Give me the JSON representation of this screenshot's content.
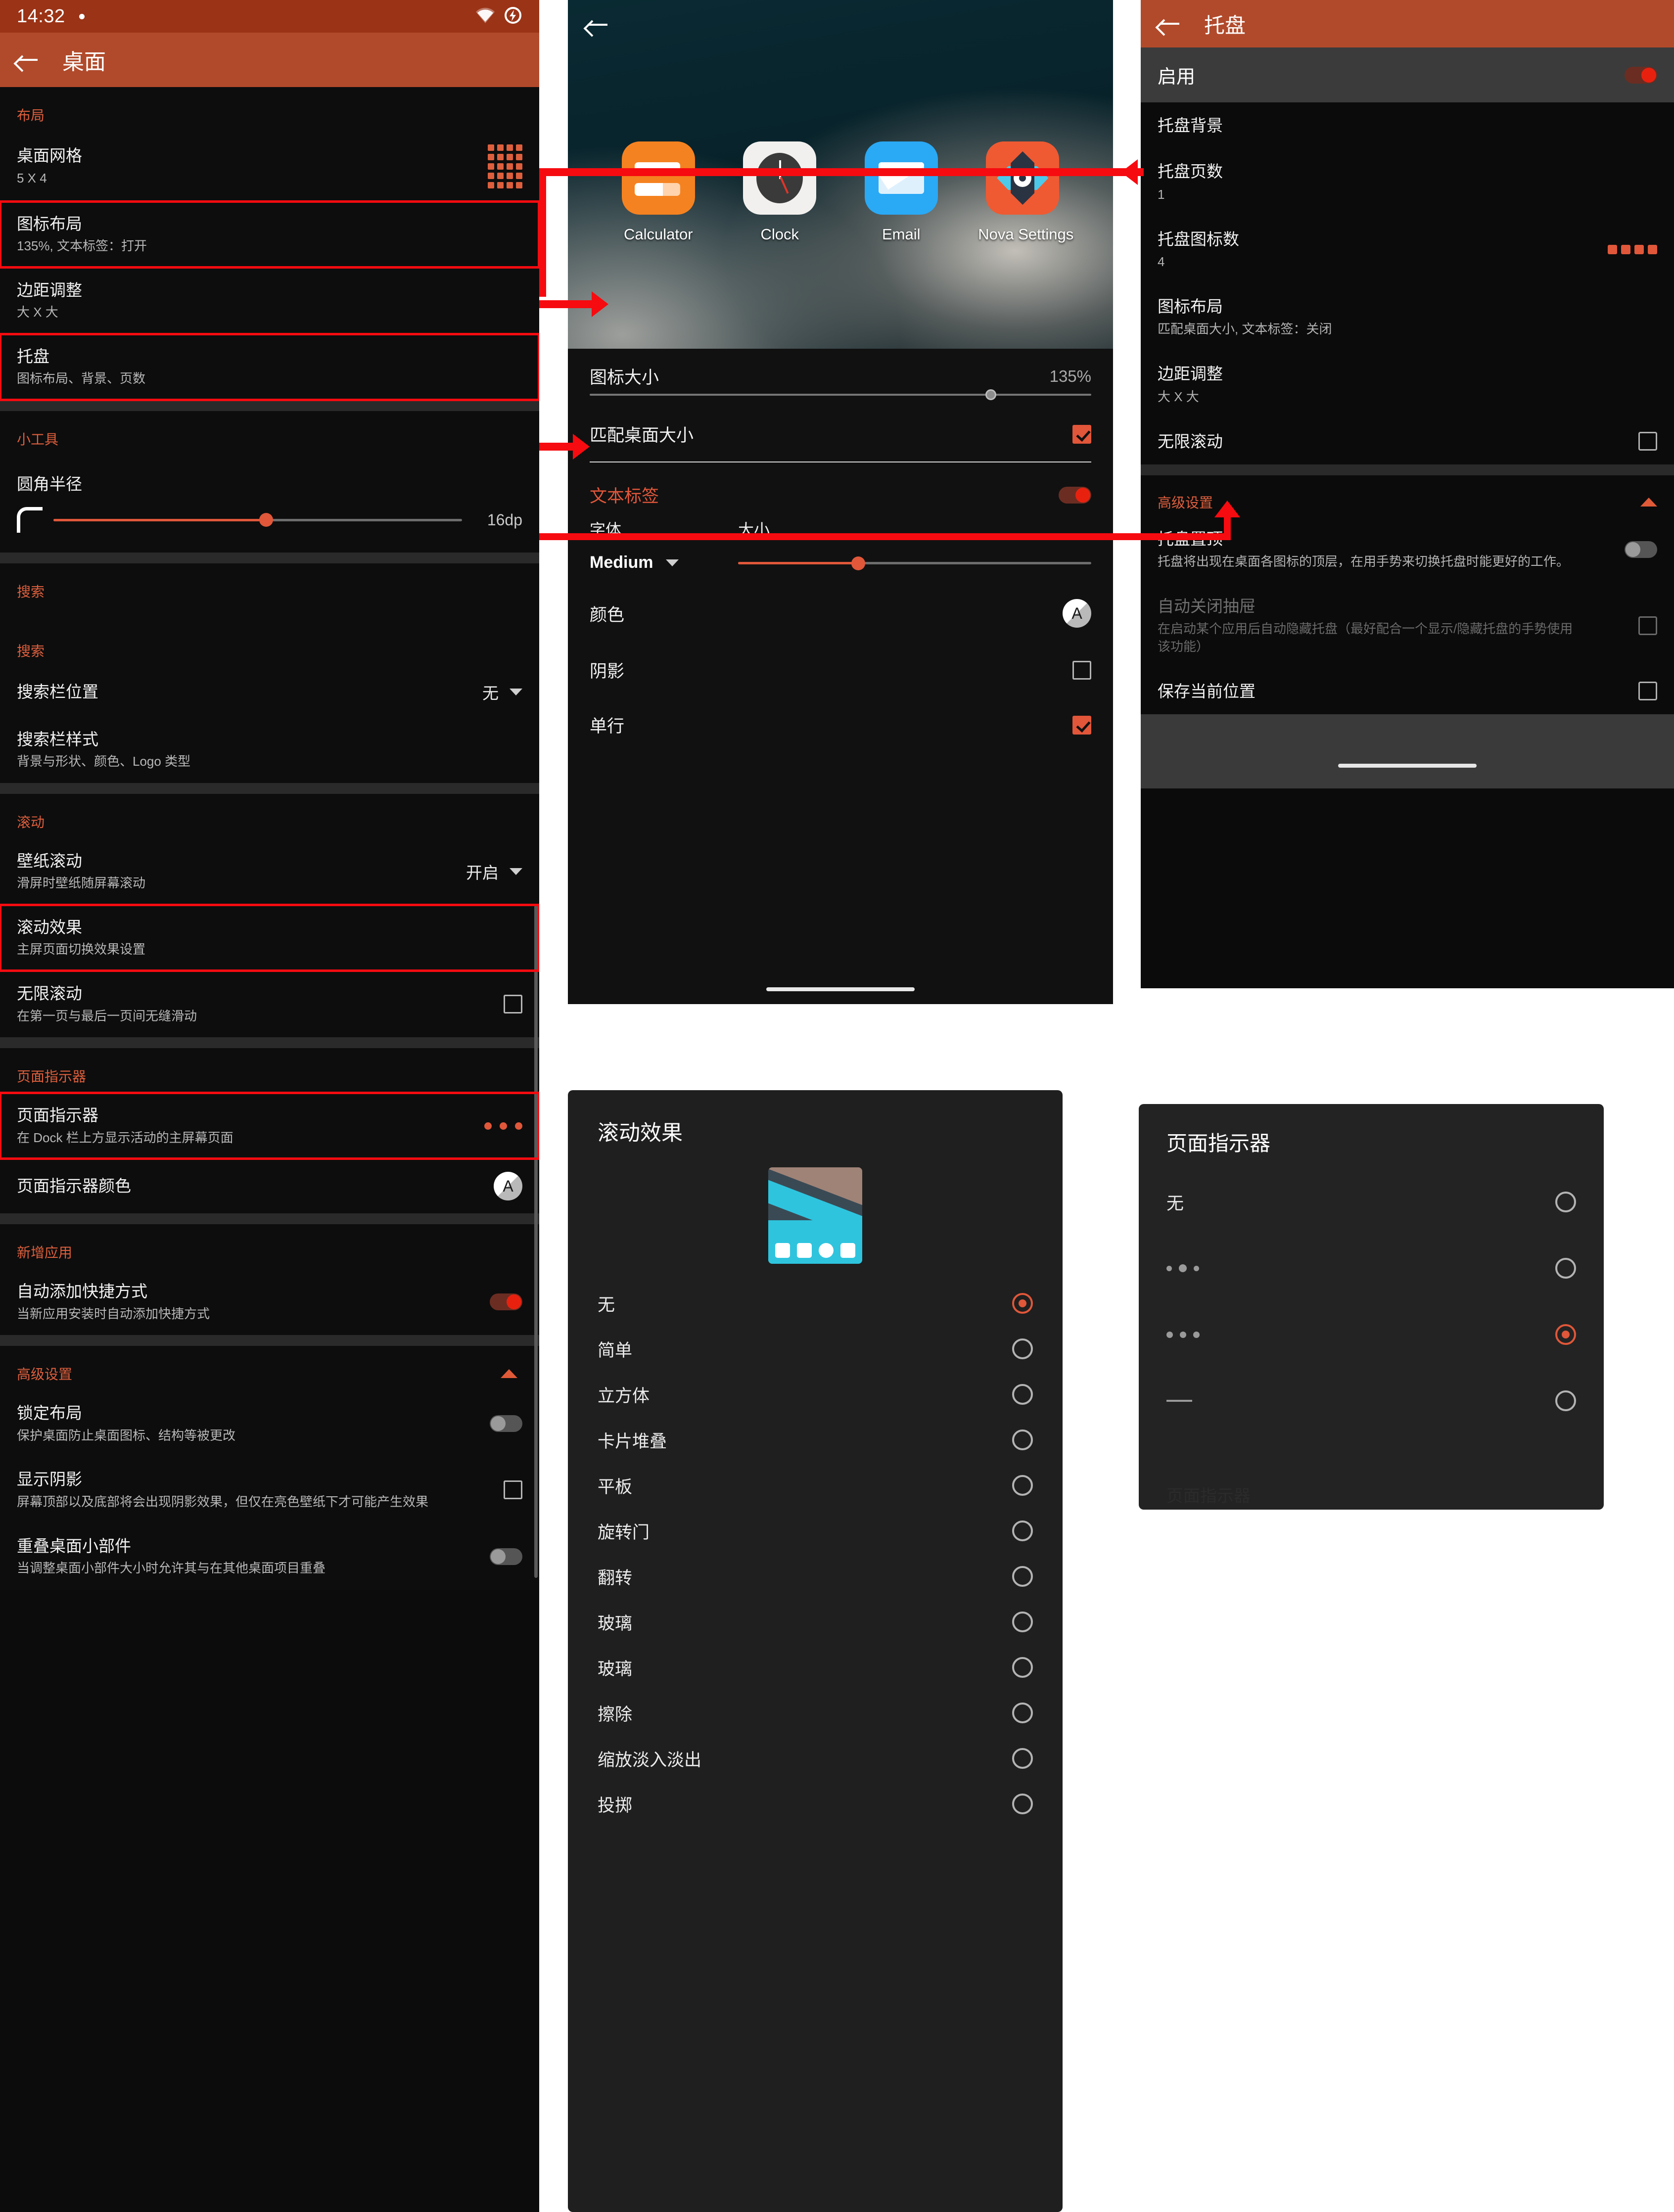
{
  "status_bar": {
    "time": "14:32",
    "icons": [
      "wifi-icon",
      "battery-charging-icon"
    ]
  },
  "left_panel": {
    "appbar": {
      "title": "桌面",
      "back_icon": "back-arrow-icon"
    },
    "sections": [
      {
        "category": "布局",
        "rows": [
          {
            "title": "桌面网格",
            "subtitle": "5 X 4",
            "control": "grid-5x4-icon"
          },
          {
            "title": "图标布局",
            "subtitle": "135%, 文本标签：打开",
            "control": "none",
            "highlighted": true
          },
          {
            "title": "边距调整",
            "subtitle": "大 X 大",
            "control": "none"
          },
          {
            "title": "托盘",
            "subtitle": "图标布局、背景、页数",
            "control": "none",
            "highlighted": true
          }
        ]
      },
      {
        "category": "小工具",
        "rows": [
          {
            "title": "圆角半径",
            "subtitle": "",
            "control": "slider",
            "value": "16dp",
            "percent": 52
          }
        ]
      },
      {
        "category": "搜索",
        "rows": []
      },
      {
        "category": "搜索",
        "rows": [
          {
            "title": "搜索栏位置",
            "subtitle": "",
            "control": "dropdown",
            "value": "无"
          },
          {
            "title": "搜索栏样式",
            "subtitle": "背景与形状、颜色、Logo 类型",
            "control": "none"
          }
        ]
      },
      {
        "category": "滚动",
        "rows": [
          {
            "title": "壁纸滚动",
            "subtitle": "滑屏时壁纸随屏幕滚动",
            "control": "dropdown",
            "value": "开启"
          },
          {
            "title": "滚动效果",
            "subtitle": "主屏页面切换效果设置",
            "control": "none",
            "highlighted": true
          },
          {
            "title": "无限滚动",
            "subtitle": "在第一页与最后一页间无缝滑动",
            "control": "checkbox",
            "checked": false
          }
        ]
      },
      {
        "category": "页面指示器",
        "rows": [
          {
            "title": "页面指示器",
            "subtitle": "在 Dock 栏上方显示活动的主屏幕页面",
            "control": "dots3",
            "highlighted": true
          },
          {
            "title": "页面指示器颜色",
            "subtitle": "",
            "control": "color-swatch",
            "value": "A"
          }
        ]
      },
      {
        "category": "新增应用",
        "rows": [
          {
            "title": "自动添加快捷方式",
            "subtitle": "当新应用安装时自动添加快捷方式",
            "control": "toggle",
            "on": true
          }
        ]
      },
      {
        "category": "高级设置",
        "collapse_icon": "caret-up-icon",
        "rows": [
          {
            "title": "锁定布局",
            "subtitle": "保护桌面防止桌面图标、结构等被更改",
            "control": "toggle",
            "on": false
          },
          {
            "title": "显示阴影",
            "subtitle": "屏幕顶部以及底部将会出现阴影效果，但仅在亮色壁纸下才可能产生效果",
            "control": "checkbox",
            "checked": false
          },
          {
            "title": "重叠桌面小部件",
            "subtitle": "当调整桌面小部件大小时允许其与在其他桌面项目重叠",
            "control": "toggle",
            "on": false
          }
        ]
      }
    ]
  },
  "mid_panel": {
    "back_icon": "back-arrow-icon",
    "preview_apps": [
      {
        "label": "Calculator",
        "icon": "calculator-icon"
      },
      {
        "label": "Clock",
        "icon": "clock-icon"
      },
      {
        "label": "Email",
        "icon": "email-icon"
      },
      {
        "label": "Nova Settings",
        "icon": "nova-settings-icon"
      }
    ],
    "icon_size": {
      "label": "图标大小",
      "value": "135%",
      "percent": 80
    },
    "match_desktop": {
      "label": "匹配桌面大小",
      "checked": true
    },
    "text_label": {
      "label": "文本标签",
      "on": true
    },
    "font": {
      "label": "字体",
      "value": "Medium"
    },
    "size": {
      "label": "大小",
      "percent": 34
    },
    "color": {
      "label": "颜色",
      "swatch": "A"
    },
    "shadow": {
      "label": "阴影",
      "checked": false
    },
    "single_line": {
      "label": "单行",
      "checked": true
    }
  },
  "right_panel": {
    "appbar": {
      "title": "托盘",
      "back_icon": "back-arrow-icon"
    },
    "enable": {
      "label": "启用",
      "on": true
    },
    "rows": [
      {
        "title": "托盘背景",
        "subtitle": "",
        "control": "none"
      },
      {
        "title": "托盘页数",
        "subtitle": "1",
        "control": "none"
      },
      {
        "title": "托盘图标数",
        "subtitle": "4",
        "control": "dots4"
      },
      {
        "title": "图标布局",
        "subtitle": "匹配桌面大小, 文本标签：关闭",
        "control": "none"
      },
      {
        "title": "边距调整",
        "subtitle": "大 X 大",
        "control": "none"
      },
      {
        "title": "无限滚动",
        "subtitle": "",
        "control": "checkbox",
        "checked": false
      }
    ],
    "advanced": {
      "category": "高级设置",
      "collapse_icon": "caret-up-icon",
      "rows": [
        {
          "title": "托盘置顶",
          "subtitle": "托盘将出现在桌面各图标的顶层，在用手势来切换托盘时能更好的工作。",
          "control": "toggle",
          "on": false,
          "dim": false
        },
        {
          "title": "自动关闭抽屉",
          "subtitle": "在启动某个应用后自动隐藏托盘（最好配合一个显示/隐藏托盘的手势使用该功能）",
          "control": "checkbox",
          "checked": false,
          "dim": true
        },
        {
          "title": "保存当前位置",
          "subtitle": "",
          "control": "checkbox",
          "checked": false,
          "dim": false
        }
      ]
    }
  },
  "dialog_scroll_effect": {
    "title": "滚动效果",
    "thumbnail": "wallpaper-dock-thumbnail",
    "options": [
      {
        "label": "无",
        "selected": true
      },
      {
        "label": "简单",
        "selected": false
      },
      {
        "label": "立方体",
        "selected": false
      },
      {
        "label": "卡片堆叠",
        "selected": false
      },
      {
        "label": "平板",
        "selected": false
      },
      {
        "label": "旋转门",
        "selected": false
      },
      {
        "label": "翻转",
        "selected": false
      },
      {
        "label": "玻璃",
        "selected": false
      },
      {
        "label": "玻璃",
        "selected": false
      },
      {
        "label": "擦除",
        "selected": false
      },
      {
        "label": "缩放淡入淡出",
        "selected": false
      },
      {
        "label": "投掷",
        "selected": false
      }
    ]
  },
  "dialog_page_indicator": {
    "title": "页面指示器",
    "ghost_label": "页面指示器",
    "options": [
      {
        "label": "无",
        "glyph": "text",
        "selected": false
      },
      {
        "label": "",
        "glyph": "dots-pill",
        "selected": false
      },
      {
        "label": "",
        "glyph": "dots-equal",
        "selected": true
      },
      {
        "label": "",
        "glyph": "dash",
        "selected": false
      }
    ]
  },
  "annotation": {
    "color": "#f60b10",
    "arrows": 4
  }
}
